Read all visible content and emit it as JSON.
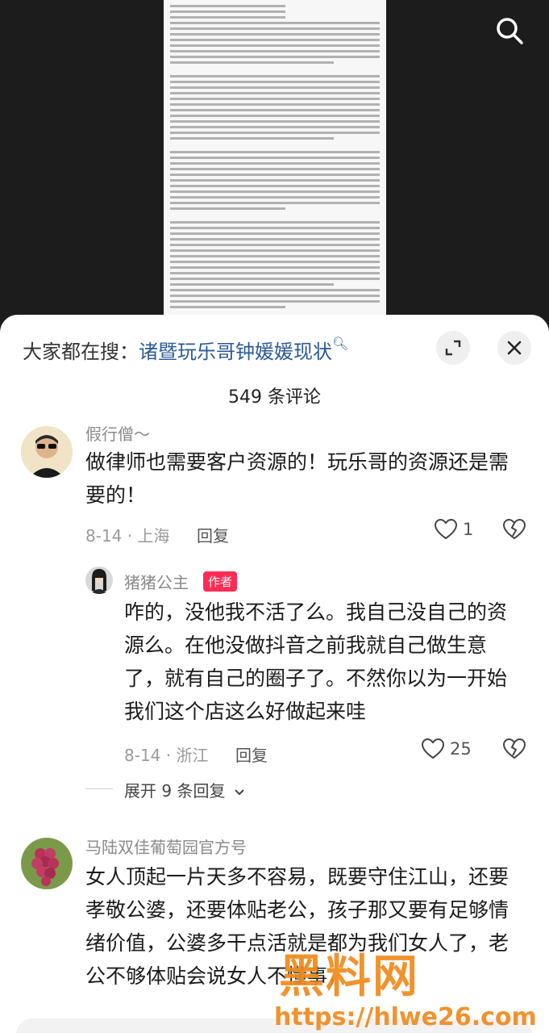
{
  "sheet": {
    "search_prefix": "大家都在搜：",
    "search_link": "诸暨玩乐哥钟媛媛现状",
    "comment_count": "549 条评论"
  },
  "comments": [
    {
      "username": "假行僧～",
      "text": "做律师也需要客户资源的！玩乐哥的资源还是需要的！",
      "date_loc": "8-14 · 上海",
      "reply_label": "回复",
      "likes": "1"
    },
    {
      "username": "猪猪公主",
      "tag": "作者",
      "text": "咋的，没他我不活了么。我自己没自己的资源么。在他没做抖音之前我就自己做生意了，就有自己的圈子了。不然你以为一开始我们这个店这么好做起来哇",
      "date_loc": "8-14 · 浙江",
      "reply_label": "回复",
      "likes": "25"
    },
    {
      "username": "马陆双佳葡萄园官方号",
      "text": "女人顶起一片天多不容易，既要守住江山，还要孝敬公婆，还要体贴老公，孩子那又要有足够情绪价值，公婆多干点活就是都为我们女人了，老公不够体贴会说女人不懂事，"
    }
  ],
  "expand_replies": "展开 9 条回复",
  "watermark": {
    "logo": "黑料网",
    "url": "https://hlwe26.com"
  },
  "colors": {
    "tag_bg": "#fe2c55",
    "link": "#2b5a9a",
    "watermark": "#f08a1c"
  }
}
